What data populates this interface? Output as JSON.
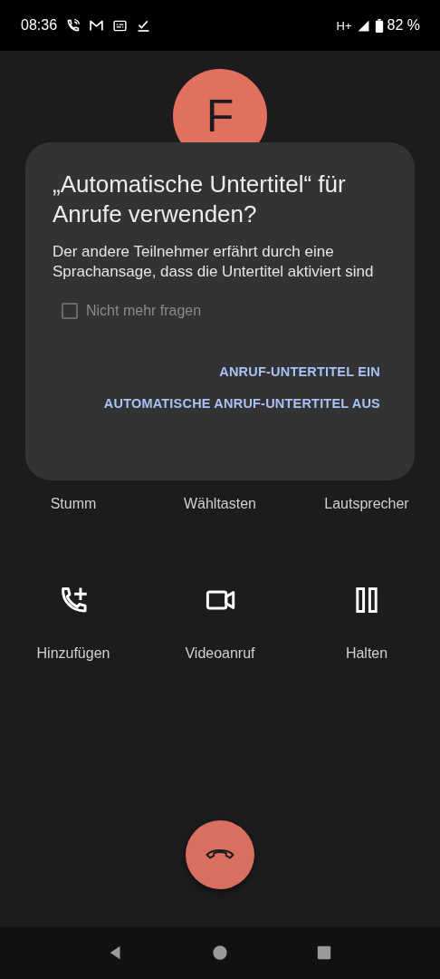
{
  "status_bar": {
    "time": "08:36",
    "network": "H+",
    "battery": "82 %"
  },
  "avatar": {
    "letter": "F"
  },
  "call_buttons": [
    [
      {
        "label": "Stumm"
      },
      {
        "label": "Wähltasten"
      },
      {
        "label": "Lautsprecher"
      }
    ],
    [
      {
        "label": "Hinzufügen",
        "kind": "add_call"
      },
      {
        "label": "Videoanruf",
        "kind": "video"
      },
      {
        "label": "Halten",
        "kind": "hold"
      }
    ]
  ],
  "dialog": {
    "title": "„Automatische Untertitel“ für Anrufe verwenden?",
    "message": "Der andere Teilnehmer erfährt durch eine Sprachansage, dass die Untertitel aktiviert sind",
    "checkbox": {
      "label": "Nicht mehr fragen",
      "checked": false
    },
    "buttons": [
      "ANRUF-UNTERTITEL EIN",
      "AUTOMATISCHE ANRUF-UNTERTITEL AUS"
    ]
  }
}
